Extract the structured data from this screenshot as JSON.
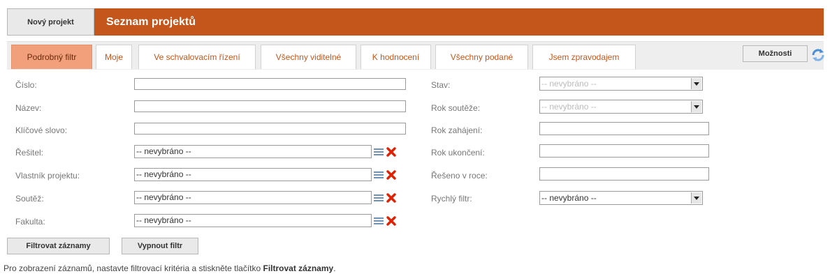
{
  "header": {
    "new_project_label": "Nový projekt",
    "title": "Seznam projektů"
  },
  "tabs": [
    {
      "label": "Podrobný filtr",
      "active": true
    },
    {
      "label": "Moje",
      "active": false
    },
    {
      "label": "Ve schvalovacím řízení",
      "active": false
    },
    {
      "label": "Všechny viditelné",
      "active": false
    },
    {
      "label": "K hodnocení",
      "active": false
    },
    {
      "label": "Všechny podané",
      "active": false
    },
    {
      "label": "Jsem zpravodajem",
      "active": false
    }
  ],
  "toolbar": {
    "options_label": "Možnosti",
    "refresh_icon": "refresh-icon"
  },
  "filter_left": [
    {
      "label": "Číslo:",
      "value": ""
    },
    {
      "label": "Název:",
      "value": ""
    },
    {
      "label": "Klíčové slovo:",
      "value": ""
    },
    {
      "label": "Řešitel:",
      "value": "-- nevybráno --"
    },
    {
      "label": "Vlastník projektu:",
      "value": "-- nevybráno --"
    },
    {
      "label": "Soutěž:",
      "value": "-- nevybráno --"
    },
    {
      "label": "Fakulta:",
      "value": "-- nevybráno --"
    }
  ],
  "filter_right": [
    {
      "label": "Stav:",
      "value": "-- nevybráno --"
    },
    {
      "label": "Rok soutěže:",
      "value": "-- nevybráno --"
    },
    {
      "label": "Rok zahájení:",
      "value": ""
    },
    {
      "label": "Rok ukončení:",
      "value": ""
    },
    {
      "label": "Řešeno v roce:",
      "value": ""
    },
    {
      "label": "Rychlý filtr:",
      "value": "-- nevybráno --"
    }
  ],
  "buttons": {
    "filter_label": "Filtrovat záznamy",
    "off_label": "Vypnout filtr"
  },
  "info": {
    "text_before": "Pro zobrazení záznamů, nastavte filtrovací kritéria a stiskněte tlačítko ",
    "button_ref": "Filtrovat záznamy",
    "text_after": "."
  },
  "colors": {
    "brand": "#c4561c",
    "active_tab": "#f2a07c",
    "delete_icon": "#e02000",
    "list_icon": "#6f93b8"
  }
}
